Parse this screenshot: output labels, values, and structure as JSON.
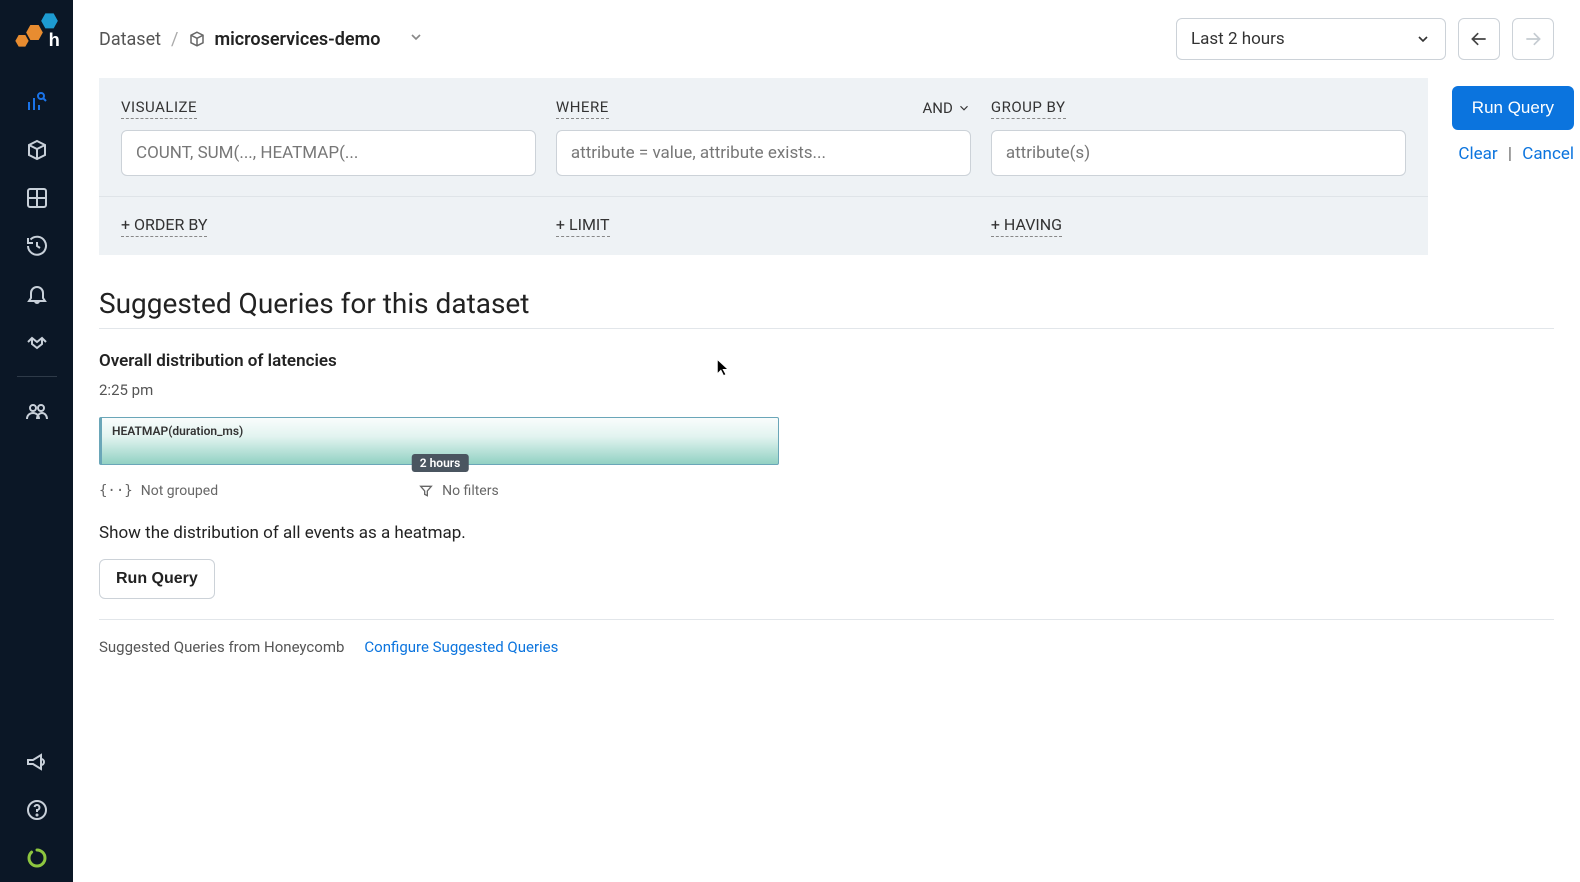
{
  "breadcrumb": {
    "root": "Dataset",
    "dataset": "microservices-demo"
  },
  "time": {
    "selected": "Last 2 hours"
  },
  "query": {
    "visualize": {
      "label": "VISUALIZE",
      "placeholder": "COUNT, SUM(..., HEATMAP(..."
    },
    "where": {
      "label": "WHERE",
      "and": "AND",
      "placeholder": "attribute = value, attribute exists..."
    },
    "groupby": {
      "label": "GROUP BY",
      "placeholder": "attribute(s)"
    },
    "orderby": "+ ORDER BY",
    "limit": "+ LIMIT",
    "having": "+ HAVING"
  },
  "actions": {
    "run": "Run Query",
    "clear": "Clear",
    "cancel": "Cancel"
  },
  "suggest": {
    "heading": "Suggested Queries for this dataset",
    "item": {
      "title": "Overall distribution of latencies",
      "time": "2:25 pm",
      "heatmap_label": "HEATMAP(duration_ms)",
      "badge": "2 hours",
      "not_grouped": "Not grouped",
      "no_filters": "No filters",
      "desc": "Show the distribution of all events as a heatmap.",
      "run": "Run Query"
    },
    "footer": {
      "label": "Suggested Queries from Honeycomb",
      "configure": "Configure Suggested Queries"
    }
  },
  "colors": {
    "accent": "#0b74de",
    "sidebar": "#0b1726"
  }
}
